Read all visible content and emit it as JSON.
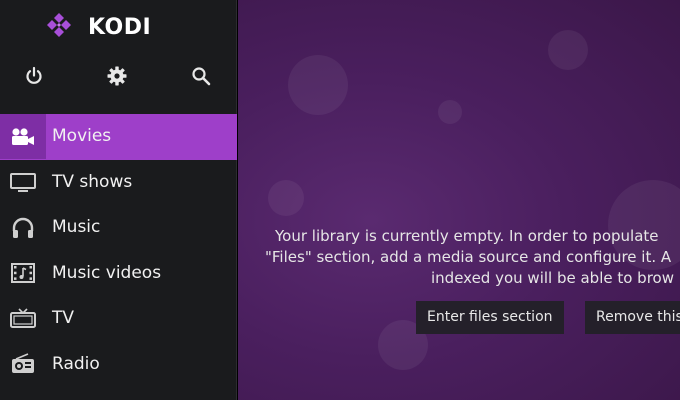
{
  "app": {
    "name": "KODI"
  },
  "sidebar": {
    "top_icons": [
      "power-icon",
      "settings-icon",
      "search-icon"
    ],
    "items": [
      {
        "label": "Movies",
        "icon": "movie-camera-icon",
        "active": true
      },
      {
        "label": "TV shows",
        "icon": "tv-icon",
        "active": false
      },
      {
        "label": "Music",
        "icon": "headphones-icon",
        "active": false
      },
      {
        "label": "Music videos",
        "icon": "film-strip-icon",
        "active": false
      },
      {
        "label": "TV",
        "icon": "tv-set-icon",
        "active": false
      },
      {
        "label": "Radio",
        "icon": "radio-icon",
        "active": false
      }
    ]
  },
  "main": {
    "message_lines": [
      "Your library is currently empty. In order to populate",
      "\"Files\" section, add a media source and configure it. A",
      "indexed you will be able to brow"
    ],
    "buttons": {
      "enter_files": "Enter files section",
      "remove_this": "Remove this"
    }
  },
  "colors": {
    "accent": "#9e3fc9",
    "accent_dark": "#7e2ea5",
    "sidebar_bg": "#1a1b1d",
    "main_bg": "#4a1f5e"
  }
}
